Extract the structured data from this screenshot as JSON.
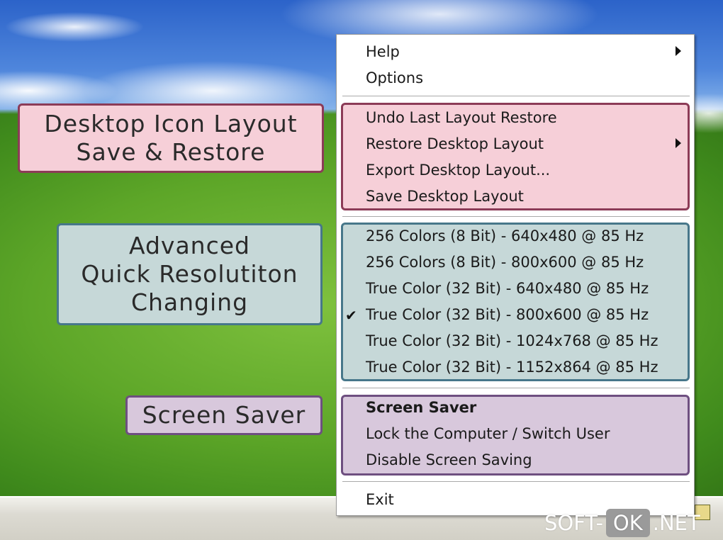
{
  "callouts": {
    "layout": [
      "Desktop Icon Layout",
      "Save & Restore"
    ],
    "resolution": [
      "Advanced",
      "Quick Resolutiton",
      "Changing"
    ],
    "saver": [
      "Screen Saver"
    ]
  },
  "menu": {
    "top": [
      {
        "label": "Help",
        "submenu": true
      },
      {
        "label": "Options",
        "submenu": false
      }
    ],
    "layout_group": [
      {
        "label": "Undo Last Layout Restore",
        "submenu": false
      },
      {
        "label": "Restore Desktop Layout",
        "submenu": true
      },
      {
        "label": "Export Desktop Layout...",
        "submenu": false
      },
      {
        "label": "Save Desktop Layout",
        "submenu": false
      }
    ],
    "resolution_group": [
      {
        "label": "256 Colors (8 Bit) - 640x480 @ 85 Hz",
        "checked": false
      },
      {
        "label": "256 Colors (8 Bit) - 800x600 @ 85 Hz",
        "checked": false
      },
      {
        "label": "True Color (32 Bit) - 640x480 @ 85 Hz",
        "checked": false
      },
      {
        "label": "True Color (32 Bit) - 800x600 @ 85 Hz",
        "checked": true
      },
      {
        "label": "True Color (32 Bit) - 1024x768 @ 85 Hz",
        "checked": false
      },
      {
        "label": "True Color (32 Bit) - 1152x864 @ 85 Hz",
        "checked": false
      }
    ],
    "saver_group": [
      {
        "label": "Screen Saver",
        "bold": true
      },
      {
        "label": "Lock the Computer / Switch User",
        "bold": false
      },
      {
        "label": "Disable Screen Saving",
        "bold": false
      }
    ],
    "exit": {
      "label": "Exit"
    },
    "check_glyph": "✔"
  },
  "watermark": {
    "left": "SOFT-",
    "middle": "OK",
    "right": ".NET"
  },
  "colors": {
    "layout_fill": "#f6cfd8",
    "layout_border": "#8c3b57",
    "resolution_fill": "#c6d8d8",
    "resolution_border": "#47778a",
    "saver_fill": "#d8c8dc",
    "saver_border": "#6e4f80"
  }
}
